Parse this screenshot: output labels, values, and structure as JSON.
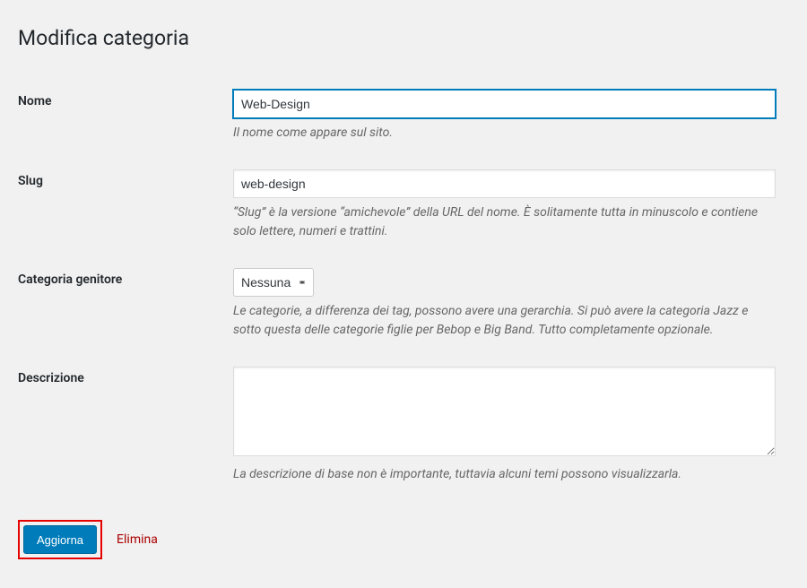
{
  "page": {
    "title": "Modifica categoria"
  },
  "fields": {
    "name": {
      "label": "Nome",
      "value": "Web-Design",
      "description": "Il nome come appare sul sito."
    },
    "slug": {
      "label": "Slug",
      "value": "web-design",
      "description": "“Slug” è la versione “amichevole” della URL del nome. È solitamente tutta in minuscolo e contiene solo lettere, numeri e trattini."
    },
    "parent": {
      "label": "Categoria genitore",
      "selected": "Nessuna",
      "description": "Le categorie, a differenza dei tag, possono avere una gerarchia. Si può avere la categoria Jazz e sotto questa delle categorie figlie per Bebop e Big Band. Tutto completamente opzionale."
    },
    "description": {
      "label": "Descrizione",
      "value": "",
      "description": "La descrizione di base non è importante, tuttavia alcuni temi possono visualizzarla."
    }
  },
  "actions": {
    "update": "Aggiorna",
    "delete": "Elimina"
  }
}
